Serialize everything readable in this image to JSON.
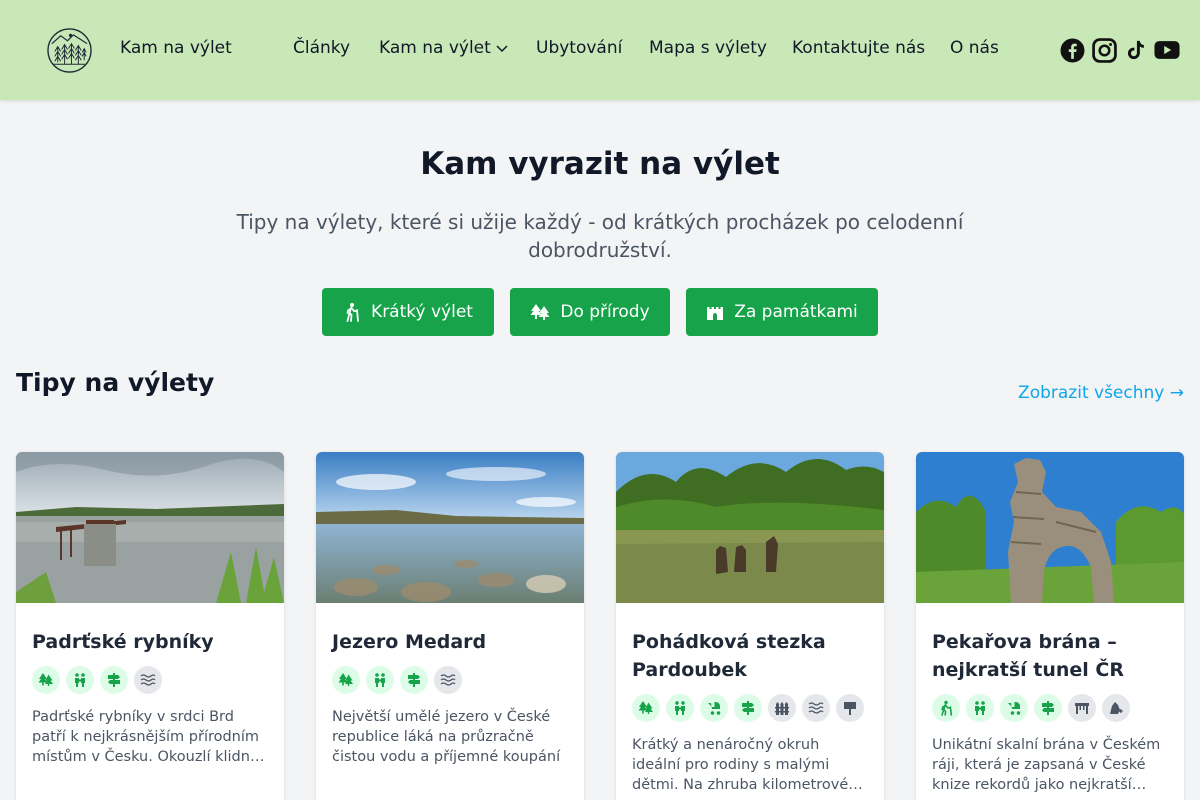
{
  "header": {
    "brand": "Kam na výlet",
    "logo_icon": "forest-logo-icon",
    "nav": [
      {
        "label": "Články"
      },
      {
        "label": "Kam na výlet",
        "has_dropdown": true
      },
      {
        "label": "Ubytování"
      },
      {
        "label": "Mapa s výlety"
      },
      {
        "label": "Kontaktujte nás"
      },
      {
        "label": "O nás"
      }
    ],
    "social": [
      "facebook-icon",
      "instagram-icon",
      "tiktok-icon",
      "youtube-icon"
    ]
  },
  "hero": {
    "title": "Kam vyrazit na výlet",
    "subtitle": "Tipy na výlety, které si užije každý - od krátkých procházek po celodenní dobrodružství.",
    "buttons": [
      {
        "label": "Krátký výlet",
        "icon": "hiker-icon"
      },
      {
        "label": "Do přírody",
        "icon": "trees-icon"
      },
      {
        "label": "Za památkami",
        "icon": "castle-icon"
      }
    ]
  },
  "section": {
    "title": "Tipy na výlety",
    "see_all": "Zobrazit všechny →"
  },
  "cards": [
    {
      "title": "Padrťské rybníky",
      "tags": [
        "trees-icon",
        "family-icon",
        "signpost-icon",
        "water-icon"
      ],
      "description": "Padrťské rybníky v srdci Brd patří k nejkrásnějším přírodním místům v Česku. Okouzlí klidnou atmosférou"
    },
    {
      "title": "Jezero Medard",
      "tags": [
        "trees-icon",
        "family-icon",
        "signpost-icon",
        "water-icon"
      ],
      "description": "Největší umělé jezero v České republice láká na průzračně čistou vodu a příjemné koupání"
    },
    {
      "title": "Pohádková stezka Pardoubek",
      "tags": [
        "trees-icon",
        "family-icon",
        "stroller-icon",
        "signpost-icon",
        "fence-icon",
        "water-icon",
        "info-board-icon"
      ],
      "description": "Krátký a nenáročný okruh ideální pro rodiny s malými dětmi. Na zhruba kilometrové trase kolem rybníka"
    },
    {
      "title": "Pekařova brána – nejkratší tunel ČR",
      "tags": [
        "hiker-icon",
        "family-icon",
        "stroller-icon",
        "signpost-icon",
        "bridge-icon",
        "rock-icon"
      ],
      "description": "Unikátní skalní brána v Českém ráji, která je zapsaná v České knize rekordů jako nejkratší tunel"
    }
  ],
  "colors": {
    "header_bg": "#c9e8b7",
    "accent": "#16a34a",
    "link": "#0ea5e9",
    "page_bg": "#f3f4f6"
  }
}
